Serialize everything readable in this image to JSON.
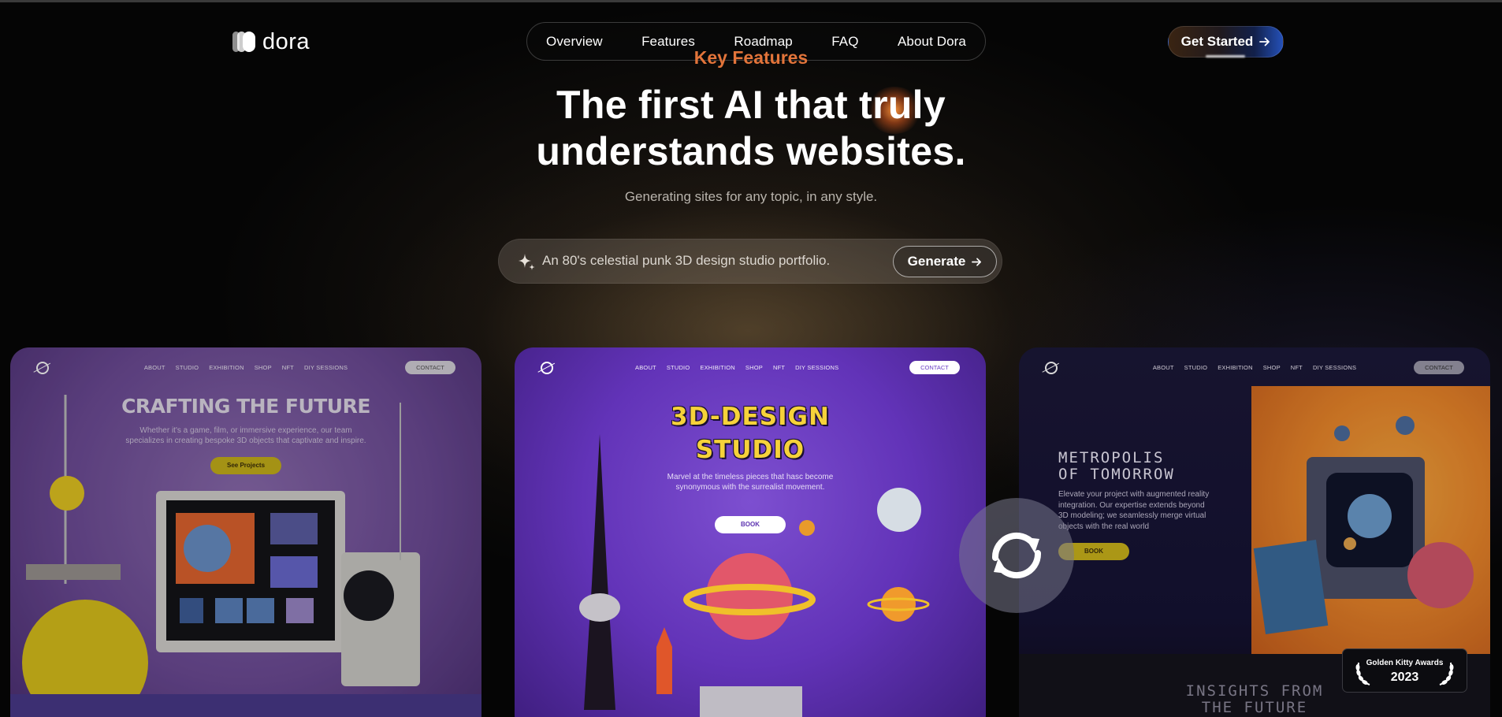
{
  "header": {
    "logo_text": "dora",
    "nav": [
      "Overview",
      "Features",
      "Roadmap",
      "FAQ",
      "About Dora"
    ],
    "cta_label": "Get Started",
    "cta_icon": "arrow-right-icon"
  },
  "hero": {
    "eyebrow": "Key Features",
    "headline_line1": "The first AI that truly",
    "headline_line2": "understands websites.",
    "subtitle": "Generating sites for any topic, in any style.",
    "prompt_icon": "sparkle-icon",
    "prompt_text": "An 80's celestial punk 3D design studio portfolio.",
    "generate_label": "Generate"
  },
  "cards": [
    {
      "nav_links": [
        "ABOUT",
        "STUDIO",
        "EXHIBITION",
        "SHOP",
        "NFT",
        "DIY SESSIONS"
      ],
      "contact": "CONTACT",
      "title": "CRAFTING THE FUTURE",
      "description": "Whether it's a game, film, or immersive experience, our team specializes in creating bespoke 3D objects that captivate and inspire.",
      "button": "See Projects"
    },
    {
      "nav_links": [
        "ABOUT",
        "STUDIO",
        "EXHIBITION",
        "SHOP",
        "NFT",
        "DIY SESSIONS"
      ],
      "contact": "CONTACT",
      "title_line1": "3D-DESIGN",
      "title_line2": "STUDIO",
      "description": "Marvel at the timeless pieces that hasc become synonymous with the surrealist movement.",
      "button": "BOOK"
    },
    {
      "nav_links": [
        "ABOUT",
        "STUDIO",
        "EXHIBITION",
        "SHOP",
        "NFT",
        "DIY SESSIONS"
      ],
      "contact": "CONTACT",
      "title_line1": "METROPOLIS",
      "title_line2": "OF TOMORROW",
      "description": "Elevate your project with augmented reality integration. Our expertise extends beyond 3D modeling; we seamlessly merge virtual objects with the real world",
      "button": "BOOK",
      "insights_line1": "INSIGHTS FROM",
      "insights_line2": "THE FUTURE"
    }
  ],
  "refresh_icon": "refresh-icon",
  "award": {
    "line1": "Golden Kitty Awards",
    "year": "2023"
  },
  "colors": {
    "accent_orange": "#e2743a",
    "card1_purple": "#6e4c98",
    "card2_purple": "#6233b8",
    "card3_navy": "#1b1838",
    "mock_yellow_button": "#c9b21a"
  }
}
